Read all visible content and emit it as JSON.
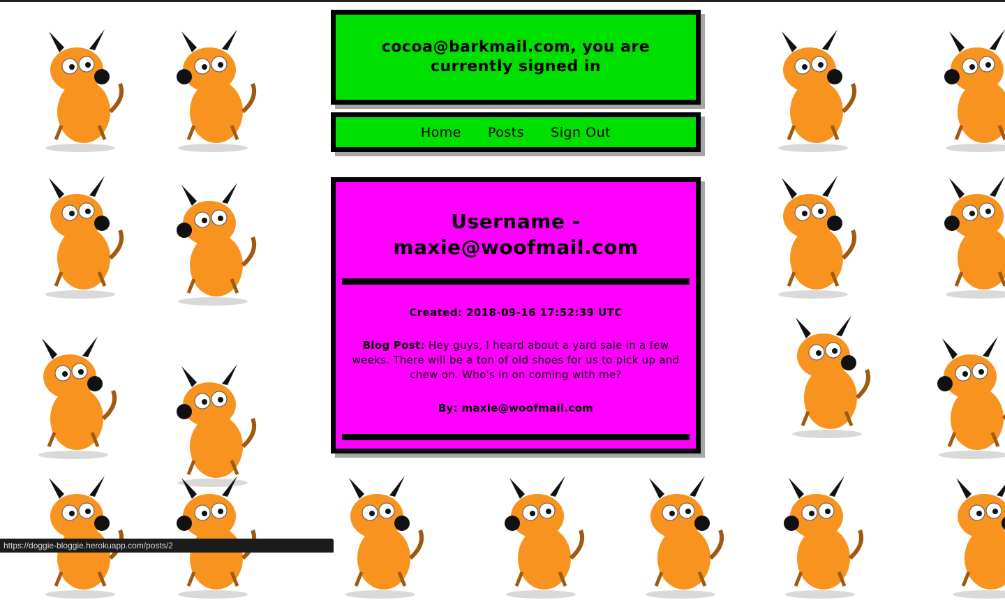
{
  "signin": {
    "message": "cocoa@barkmail.com, you are currently signed in"
  },
  "nav": {
    "home": "Home",
    "posts": "Posts",
    "sign_out": "Sign Out"
  },
  "post": {
    "title": "Username - maxie@woofmail.com",
    "created": "Created: 2018-09-16 17:52:39 UTC",
    "body_label": "Blog Post:",
    "body_text": " Hey guys, I heard about a yard sale in a few weeks. There will be a ton of old shoes for us to pick up and chew on. Who's in on coming with me?",
    "by": "By: maxie@woofmail.com"
  },
  "status_bar": {
    "url": "https://doggie-bloggie.herokuapp.com/posts/2"
  },
  "colors": {
    "panel_green": "#00e000",
    "panel_magenta": "#ff00ff",
    "dog_orange": "#f7931e"
  },
  "background": {
    "icon": "cartoon-dog-icon"
  }
}
